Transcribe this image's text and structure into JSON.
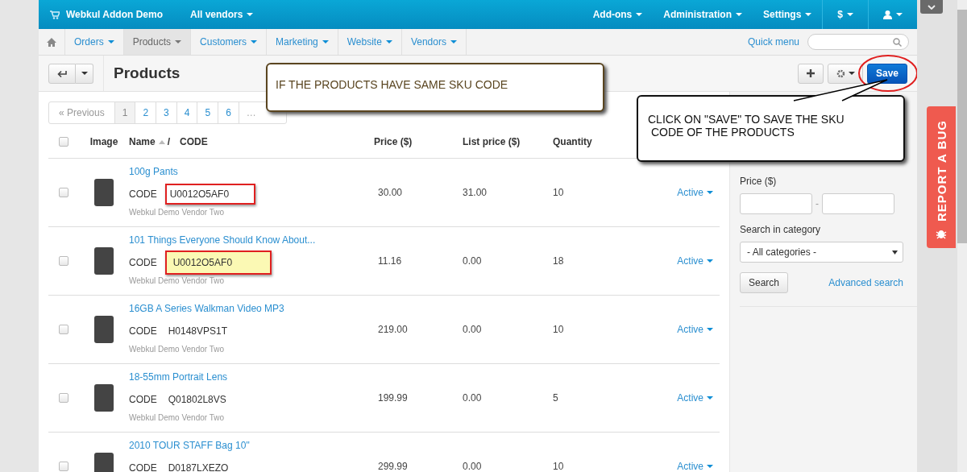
{
  "topbar": {
    "brand": "Webkul Addon Demo",
    "vendor_menu": "All vendors",
    "menus": [
      {
        "label": "Add-ons"
      },
      {
        "label": "Administration"
      },
      {
        "label": "Settings"
      },
      {
        "label": "$"
      }
    ]
  },
  "nav": {
    "items": [
      {
        "label": "Orders",
        "selected": false
      },
      {
        "label": "Products",
        "selected": true
      },
      {
        "label": "Customers",
        "selected": false
      },
      {
        "label": "Marketing",
        "selected": false
      },
      {
        "label": "Website",
        "selected": false
      },
      {
        "label": "Vendors",
        "selected": false
      }
    ],
    "quick_menu": "Quick menu"
  },
  "toolbar": {
    "title": "Products",
    "save": "Save"
  },
  "pagination": {
    "previous": "« Previous",
    "pages": [
      {
        "label": "1",
        "selected": true
      },
      {
        "label": "2",
        "selected": false
      },
      {
        "label": "3",
        "selected": false
      },
      {
        "label": "4",
        "selected": false
      },
      {
        "label": "5",
        "selected": false
      },
      {
        "label": "6",
        "selected": false
      },
      {
        "label": "…",
        "selected": false
      }
    ]
  },
  "table": {
    "select_all_checked": false,
    "columns": {
      "image": "Image",
      "name": "Name",
      "sort": "/",
      "code": "CODE",
      "price": "Price ($)",
      "list_price": "List price ($)",
      "quantity": "Quantity"
    },
    "rows": [
      {
        "name": "100g Pants",
        "code_label": "CODE",
        "code": "U0012O5AF0",
        "outlined": true,
        "highlighted": false,
        "checked": false,
        "vendor": "Webkul Demo Vendor Two",
        "price": "30.00",
        "list_price": "31.00",
        "quantity": "10",
        "status": "Active"
      },
      {
        "name": "101 Things Everyone Should Know About...",
        "code_label": "CODE",
        "code": "U0012O5AF0",
        "outlined": true,
        "highlighted": true,
        "checked": false,
        "vendor": "Webkul Demo Vendor Two",
        "price": "11.16",
        "list_price": "0.00",
        "quantity": "18",
        "status": "Active"
      },
      {
        "name": "16GB A Series Walkman Video MP3",
        "code_label": "CODE",
        "code": "H0148VPS1T",
        "outlined": false,
        "highlighted": false,
        "checked": false,
        "vendor": "Webkul Demo Vendor Two",
        "price": "219.00",
        "list_price": "0.00",
        "quantity": "10",
        "status": "Active"
      },
      {
        "name": "18-55mm Portrait Lens",
        "code_label": "CODE",
        "code": "Q01802L8VS",
        "outlined": false,
        "highlighted": false,
        "checked": false,
        "vendor": "Webkul Demo Vendor Two",
        "price": "199.99",
        "list_price": "0.00",
        "quantity": "5",
        "status": "Active"
      },
      {
        "name": "2010 TOUR STAFF Bag 10\"",
        "code_label": "CODE",
        "code": "D0187LXEZO",
        "outlined": false,
        "highlighted": false,
        "checked": false,
        "price": "299.99",
        "list_price": "0.00",
        "quantity": "10",
        "status": "Active"
      }
    ]
  },
  "sidebar": {
    "price_label": "Price ($)",
    "range_dash": "-",
    "category_label": "Search in category",
    "category_value": "- All categories -",
    "search": "Search",
    "advanced": "Advanced search"
  },
  "callouts": [
    {
      "text": "IF THE PRODUCTS HAVE SAME SKU CODE",
      "kind": "brown"
    },
    {
      "text": "CLICK ON \"SAVE\" TO SAVE THE SKU\n CODE OF THE PRODUCTS",
      "kind": "black"
    }
  ],
  "bug_tab": "REPORT A BUG"
}
